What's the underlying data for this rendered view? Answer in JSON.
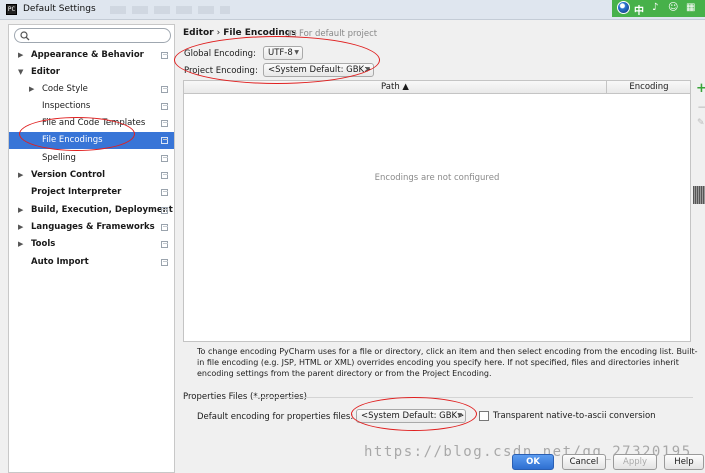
{
  "window": {
    "title": "Default Settings",
    "app_icon_text": "PC"
  },
  "sidebar": {
    "search_placeholder": "",
    "items": [
      {
        "label": "Appearance & Behavior",
        "arrow": "▶",
        "bold": true,
        "depth": 0
      },
      {
        "label": "Editor",
        "arrow": "▼",
        "bold": true,
        "depth": 0
      },
      {
        "label": "Code Style",
        "arrow": "▶",
        "bold": false,
        "depth": 1
      },
      {
        "label": "Inspections",
        "arrow": "",
        "bold": false,
        "depth": 1
      },
      {
        "label": "File and Code Templates",
        "arrow": "",
        "bold": false,
        "depth": 1
      },
      {
        "label": "File Encodings",
        "arrow": "",
        "bold": false,
        "depth": 1,
        "selected": true
      },
      {
        "label": "Spelling",
        "arrow": "",
        "bold": false,
        "depth": 1
      },
      {
        "label": "Version Control",
        "arrow": "▶",
        "bold": true,
        "depth": 0
      },
      {
        "label": "Project Interpreter",
        "arrow": "",
        "bold": true,
        "depth": 0
      },
      {
        "label": "Build, Execution, Deployment",
        "arrow": "▶",
        "bold": true,
        "depth": 0
      },
      {
        "label": "Languages & Frameworks",
        "arrow": "▶",
        "bold": true,
        "depth": 0
      },
      {
        "label": "Tools",
        "arrow": "▶",
        "bold": true,
        "depth": 0
      },
      {
        "label": "Auto Import",
        "arrow": "",
        "bold": true,
        "depth": 0
      }
    ]
  },
  "content": {
    "breadcrumb": {
      "parent": "Editor",
      "separator": "›",
      "current": "File Encodings",
      "note": "For default project"
    },
    "global_encoding": {
      "label": "Global Encoding:",
      "value": "UTF-8"
    },
    "project_encoding": {
      "label": "Project Encoding:",
      "value": "<System Default: GBK>"
    },
    "table": {
      "col_path": "Path ▲",
      "col_encoding": "Encoding",
      "empty_text": "Encodings are not configured"
    },
    "help_text": "To change encoding PyCharm uses for a file or directory, click an item and then select encoding from the encoding list. Built-in file encoding (e.g. JSP, HTML or XML) overrides encoding you specify here. If not specified, files and directories inherit encoding settings from the parent directory or from the Project Encoding.",
    "properties": {
      "section_title": "Properties Files (*.properties)",
      "default_label": "Default encoding for properties files:",
      "default_value": "<System Default: GBK>",
      "transparent_label": "Transparent native-to-ascii conversion",
      "transparent_checked": false
    }
  },
  "buttons": {
    "ok": "OK",
    "cancel": "Cancel",
    "apply": "Apply",
    "help": "Help"
  },
  "tray": {
    "glyphs": [
      "中",
      "♪",
      "☺",
      "▦"
    ]
  },
  "watermark": "https://blog.csdn.net/qq_27320195",
  "colors": {
    "selection": "#3875d7",
    "annotation": "#e02020",
    "primary_button": "#2e6fd1",
    "add_icon": "#39a339"
  }
}
